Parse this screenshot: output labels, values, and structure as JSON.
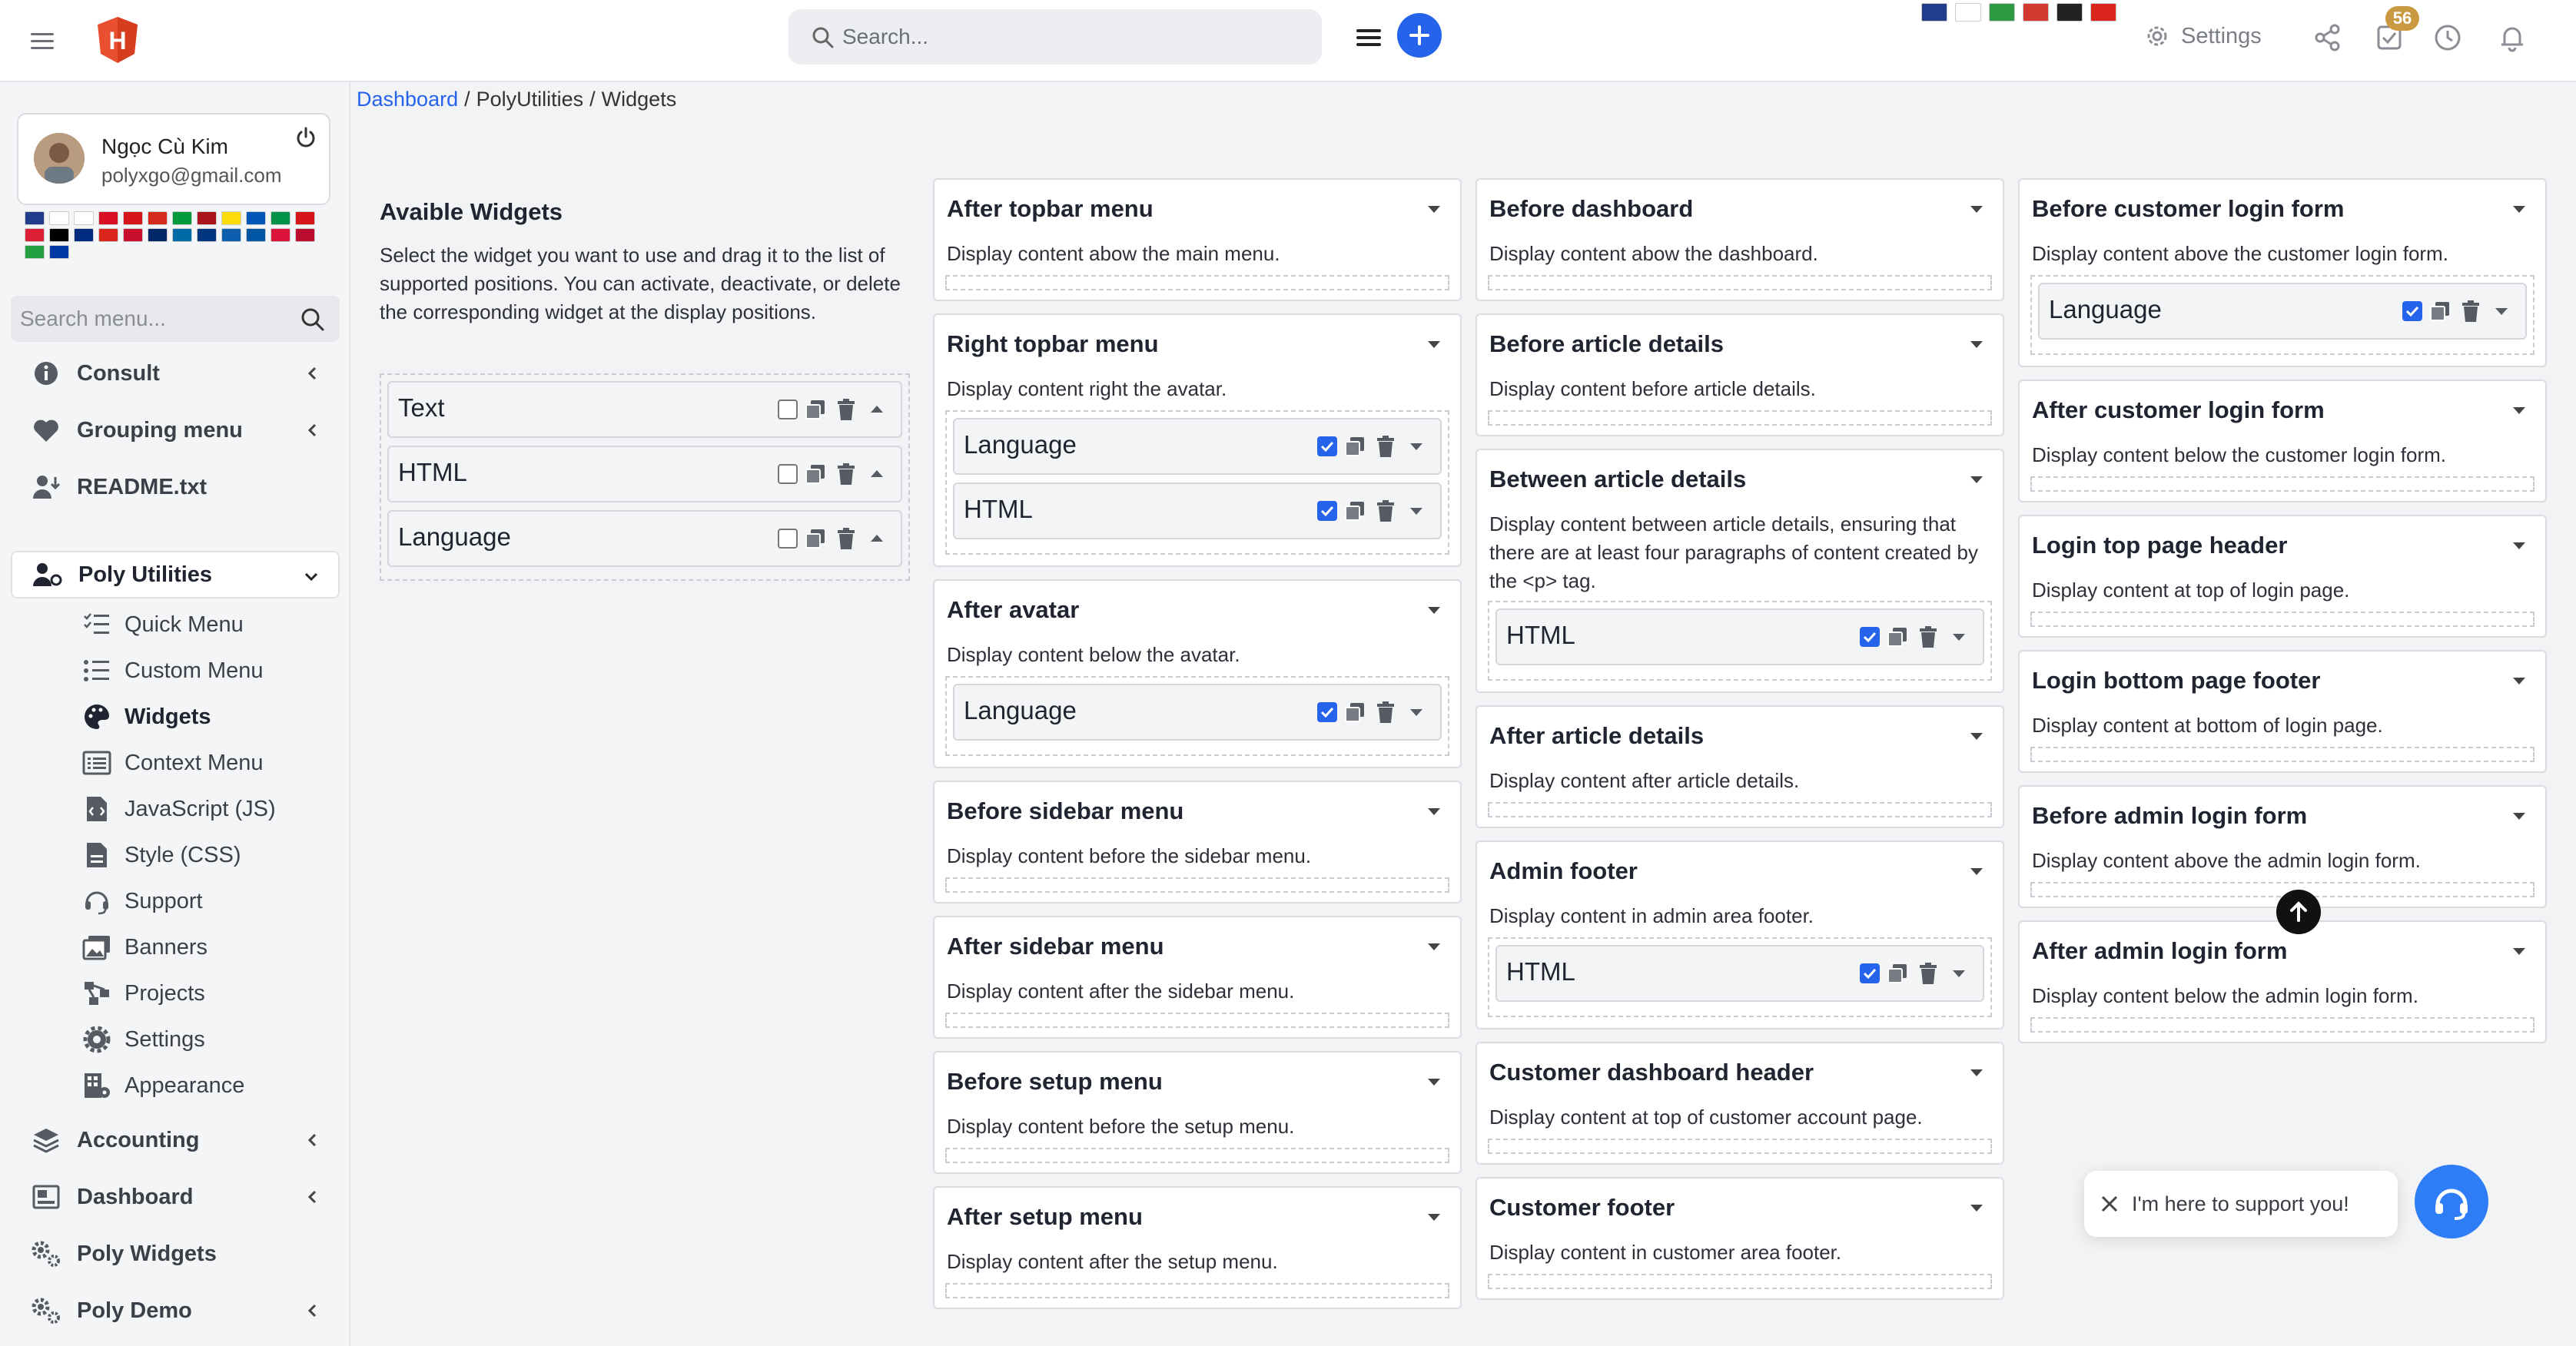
{
  "topbar": {
    "search_placeholder": "Search...",
    "settings_label": "Settings",
    "badge_count": "56",
    "flags": [
      "#1f3d8a",
      "#ffffff",
      "#2f9a41",
      "#d23a2f",
      "#222222",
      "#da251d"
    ]
  },
  "user": {
    "name": "Ngọc Cù Kim",
    "email": "polyxgo@gmail.com",
    "flags": [
      "#1f3d8a",
      "#ffffff",
      "#ffffff",
      "#d91023",
      "#d7141a",
      "#d52b1e",
      "#009c3b",
      "#aa151b",
      "#fcdd09",
      "#0057b7",
      "#009246",
      "#d7141a",
      "#dc1e35",
      "#000000",
      "#002b7f",
      "#da251d",
      "#c8102e",
      "#002868",
      "#006aa7",
      "#003580",
      "#0d5eaf",
      "#0055a4",
      "#dc143c",
      "#ba0c2f",
      "#239f40",
      "#0039a6"
    ]
  },
  "menu": {
    "search_placeholder": "Search menu...",
    "items": {
      "consult": "Consult",
      "grouping": "Grouping menu",
      "readme": "README.txt",
      "poly_utilities": "Poly Utilities",
      "accounting": "Accounting",
      "dashboard": "Dashboard",
      "poly_widgets": "Poly Widgets",
      "poly_demo": "Poly Demo"
    },
    "sub": {
      "quick_menu": "Quick Menu",
      "custom_menu": "Custom Menu",
      "widgets": "Widgets",
      "context_menu": "Context Menu",
      "javascript": "JavaScript (JS)",
      "style": "Style (CSS)",
      "support": "Support",
      "banners": "Banners",
      "projects": "Projects",
      "settings": "Settings",
      "appearance": "Appearance"
    }
  },
  "breadcrumb": {
    "home": "Dashboard",
    "section": "PolyUtilities",
    "page": "Widgets",
    "sep": "/"
  },
  "available": {
    "title": "Avaible Widgets",
    "description": "Select the widget you want to use and drag it to the list of supported positions. You can activate, deactivate, or delete the corresponding widget at the display positions.",
    "widgets": [
      "Text",
      "HTML",
      "Language"
    ]
  },
  "positions": {
    "after_topbar": {
      "title": "After topbar menu",
      "desc": "Display content abow the main menu."
    },
    "right_topbar": {
      "title": "Right topbar menu",
      "desc": "Display content right the avatar.",
      "widgets": [
        "Language",
        "HTML"
      ]
    },
    "after_avatar": {
      "title": "After avatar",
      "desc": "Display content below the avatar.",
      "widgets": [
        "Language"
      ]
    },
    "before_sidebar": {
      "title": "Before sidebar menu",
      "desc": "Display content before the sidebar menu."
    },
    "after_sidebar": {
      "title": "After sidebar menu",
      "desc": "Display content after the sidebar menu."
    },
    "before_setup": {
      "title": "Before setup menu",
      "desc": "Display content before the setup menu."
    },
    "after_setup": {
      "title": "After setup menu",
      "desc": "Display content after the setup menu."
    },
    "before_dashboard": {
      "title": "Before dashboard",
      "desc": "Display content abow the dashboard."
    },
    "before_article": {
      "title": "Before article details",
      "desc": "Display content before article details."
    },
    "between_article": {
      "title": "Between article details",
      "desc": "Display content between article details, ensuring that there are at least four paragraphs of content created by the <p> tag.",
      "widgets": [
        "HTML"
      ]
    },
    "after_article": {
      "title": "After article details",
      "desc": "Display content after article details."
    },
    "admin_footer": {
      "title": "Admin footer",
      "desc": "Display content in admin area footer.",
      "widgets": [
        "HTML"
      ]
    },
    "customer_dash_header": {
      "title": "Customer dashboard header",
      "desc": "Display content at top of customer account page."
    },
    "customer_footer": {
      "title": "Customer footer",
      "desc": "Display content in customer area footer."
    },
    "before_customer_login": {
      "title": "Before customer login form",
      "desc": "Display content above the customer login form.",
      "widgets": [
        "Language"
      ]
    },
    "after_customer_login": {
      "title": "After customer login form",
      "desc": "Display content below the customer login form."
    },
    "login_top_header": {
      "title": "Login top page header",
      "desc": "Display content at top of login page."
    },
    "login_bottom_footer": {
      "title": "Login bottom page footer",
      "desc": "Display content at bottom of login page."
    },
    "before_admin_login": {
      "title": "Before admin login form",
      "desc": "Display content above the admin login form."
    },
    "after_admin_login": {
      "title": "After admin login form",
      "desc": "Display content below the admin login form."
    }
  },
  "support": {
    "message": "I'm here to support you!"
  },
  "colors": {
    "accent": "#2563eb",
    "badge": "#c99a41",
    "support": "#2e7df6"
  }
}
